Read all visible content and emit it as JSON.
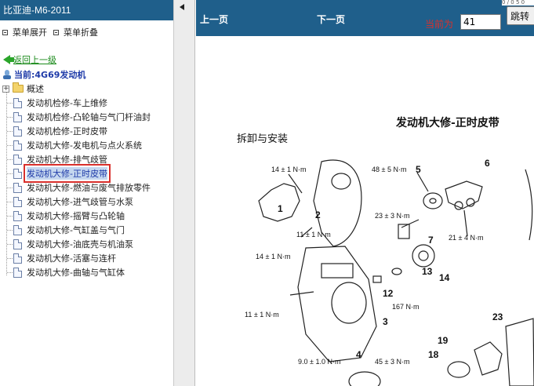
{
  "left_panel": {
    "title": "比亚迪-M6-2011",
    "expand_label": "菜单展开",
    "collapse_label": "菜单折叠",
    "back_label": "返回上一级",
    "current_label": "当前:4G69发动机",
    "folder": {
      "label": "概述",
      "toggle": "+"
    },
    "items": [
      {
        "label": "发动机检修-车上维修"
      },
      {
        "label": "发动机检修-凸轮轴与气门杆油封"
      },
      {
        "label": "发动机检修-正时皮带"
      },
      {
        "label": "发动机大修-发电机与点火系统"
      },
      {
        "label": "发动机大修-排气歧管"
      },
      {
        "label": "发动机大修-正时皮带",
        "selected": true
      },
      {
        "label": "发动机大修-燃油与废气排放零件"
      },
      {
        "label": "发动机大修-进气歧管与水泵"
      },
      {
        "label": "发动机大修-摇臂与凸轮轴"
      },
      {
        "label": "发动机大修-气缸盖与气门"
      },
      {
        "label": "发动机大修-油底壳与机油泵"
      },
      {
        "label": "发动机大修-活塞与连杆"
      },
      {
        "label": "发动机大修-曲轴与气缸体"
      }
    ]
  },
  "toolbar": {
    "prev_label": "上一页",
    "next_label": "下一页",
    "current_label": "当前为",
    "page_value": "41",
    "jump_label": "跳转",
    "corner_text": "0 / 0 5 0"
  },
  "document": {
    "title": "发动机大修-正时皮带",
    "subtitle": "拆卸与安装",
    "callouts": {
      "t1": "14 ± 1 N·m",
      "t2": "48 ± 5 N·m",
      "t3": "23 ± 3 N·m",
      "t4": "11 ± 1 N·m",
      "t5": "21 ± 4 N·m",
      "t6": "14 ± 1 N·m",
      "t7": "167 N·m",
      "t8": "11 ± 1 N·m",
      "t9": "9.0 ± 1.0 N·m",
      "t10": "45 ± 3 N·m"
    },
    "part_numbers": [
      "1",
      "2",
      "3",
      "4",
      "5",
      "6",
      "7",
      "12",
      "13",
      "14",
      "18",
      "19",
      "23"
    ]
  },
  "colors": {
    "header_bg": "#1f5f8b",
    "selection_outline": "#d9302c",
    "back_link": "#1a8a1a",
    "current_node": "#1e3aa8"
  }
}
